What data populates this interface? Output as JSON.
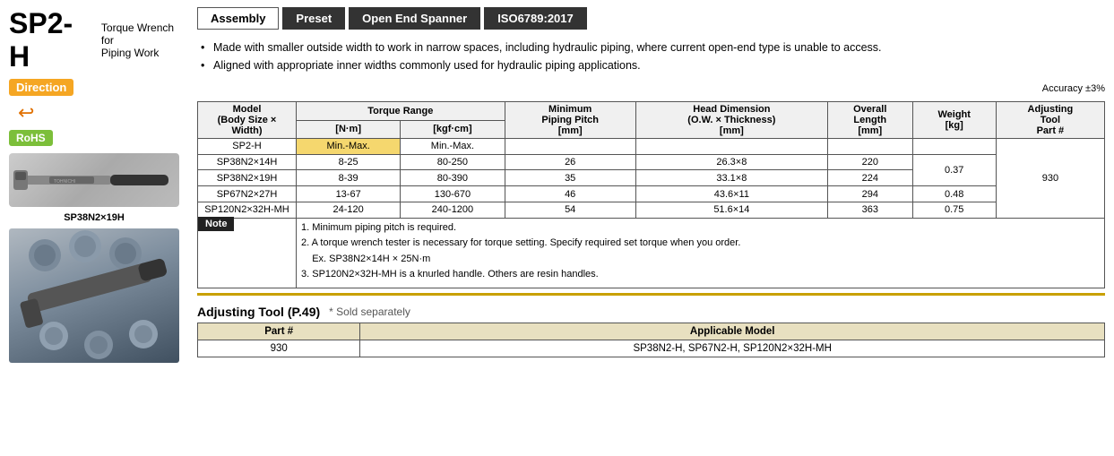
{
  "left": {
    "product_code": "SP2-H",
    "product_desc_line1": "Torque Wrench for",
    "product_desc_line2": "Piping Work",
    "direction_label": "Direction",
    "rohs_label": "RoHS",
    "model_label": "SP38N2×19H"
  },
  "tabs": [
    {
      "id": "assembly",
      "label": "Assembly",
      "active": true
    },
    {
      "id": "preset",
      "label": "Preset",
      "active": false
    },
    {
      "id": "open-end",
      "label": "Open End Spanner",
      "active": false
    },
    {
      "id": "iso",
      "label": "ISO6789:2017",
      "active": false
    }
  ],
  "bullets": [
    "Made with smaller outside width to work in narrow spaces, including hydraulic piping, where current open-end type is unable to access.",
    "Aligned with appropriate inner widths commonly used for hydraulic piping applications."
  ],
  "accuracy": "Accuracy ±3%",
  "table": {
    "headers": {
      "model": "Model\n(Body Size × Width)",
      "torque_range": "Torque Range",
      "nm": "[N·m]",
      "kgf": "[kgf·cm]",
      "min_piping_pitch": "Minimum\nPiping Pitch\n[mm]",
      "head_dim": "Head Dimension\n(O.W. × Thickness)\n[mm]",
      "overall_length": "Overall\nLength\n[mm]",
      "weight": "Weight\n[kg]",
      "adjusting_tool_part": "Adjusting\nTool\nPart #"
    },
    "rows": [
      {
        "model": "SP2-H",
        "nm": "Min.-Max.",
        "kgf": "Min.-Max.",
        "min_pitch": "",
        "head_dim": "",
        "length": "",
        "weight": "",
        "part": ""
      },
      {
        "model": "SP38N2×14H",
        "nm": "8-25",
        "kgf": "80-250",
        "min_pitch": "26",
        "head_dim": "26.3×8",
        "length": "220",
        "weight": "0.37",
        "part": "930"
      },
      {
        "model": "SP38N2×19H",
        "nm": "8-39",
        "kgf": "80-390",
        "min_pitch": "35",
        "head_dim": "33.1×8",
        "length": "224",
        "weight": "",
        "part": ""
      },
      {
        "model": "SP67N2×27H",
        "nm": "13-67",
        "kgf": "130-670",
        "min_pitch": "46",
        "head_dim": "43.6×11",
        "length": "294",
        "weight": "0.48",
        "part": ""
      },
      {
        "model": "SP120N2×32H-MH",
        "nm": "24-120",
        "kgf": "240-1200",
        "min_pitch": "54",
        "head_dim": "51.6×14",
        "length": "363",
        "weight": "0.75",
        "part": ""
      }
    ]
  },
  "notes": [
    "1. Minimum piping pitch is required.",
    "2. A torque wrench tester is necessary for torque setting. Specify required set torque when you order.\n    Ex. SP38N2×14H × 25N·m",
    "3. SP120N2×32H-MH is a knurled handle. Others are resin handles."
  ],
  "note_label": "Note",
  "adjusting_tool": {
    "title": "Adjusting Tool (P.49)",
    "subtitle": "* Sold separately",
    "headers": [
      "Part #",
      "Applicable Model"
    ],
    "rows": [
      {
        "part": "930",
        "model": "SP38N2-H, SP67N2-H, SP120N2×32H-MH"
      }
    ]
  }
}
